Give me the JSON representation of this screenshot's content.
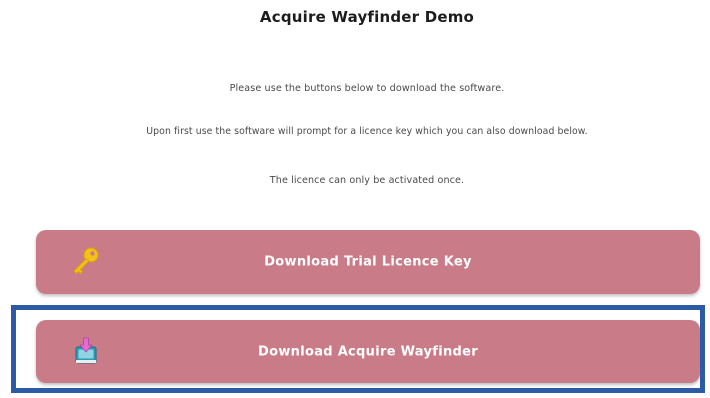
{
  "page": {
    "title": "Acquire Wayfinder Demo",
    "instructions": [
      "Please use the buttons below to download the software.",
      "Upon first use the software will prompt for a licence key which you can also download below.",
      "The licence can only be activated once."
    ]
  },
  "buttons": {
    "licence": {
      "label": "Download Trial Licence Key",
      "icon": "key-icon"
    },
    "software": {
      "label": "Download Acquire Wayfinder",
      "icon": "install-package-icon"
    }
  },
  "colors": {
    "button_bg": "#c97c88",
    "button_text": "#ffffff",
    "highlight_border": "#2d5aa5",
    "key_gold": "#f2c218",
    "package_teal": "#2d9cb5",
    "arrow_pink": "#e66ad2"
  }
}
